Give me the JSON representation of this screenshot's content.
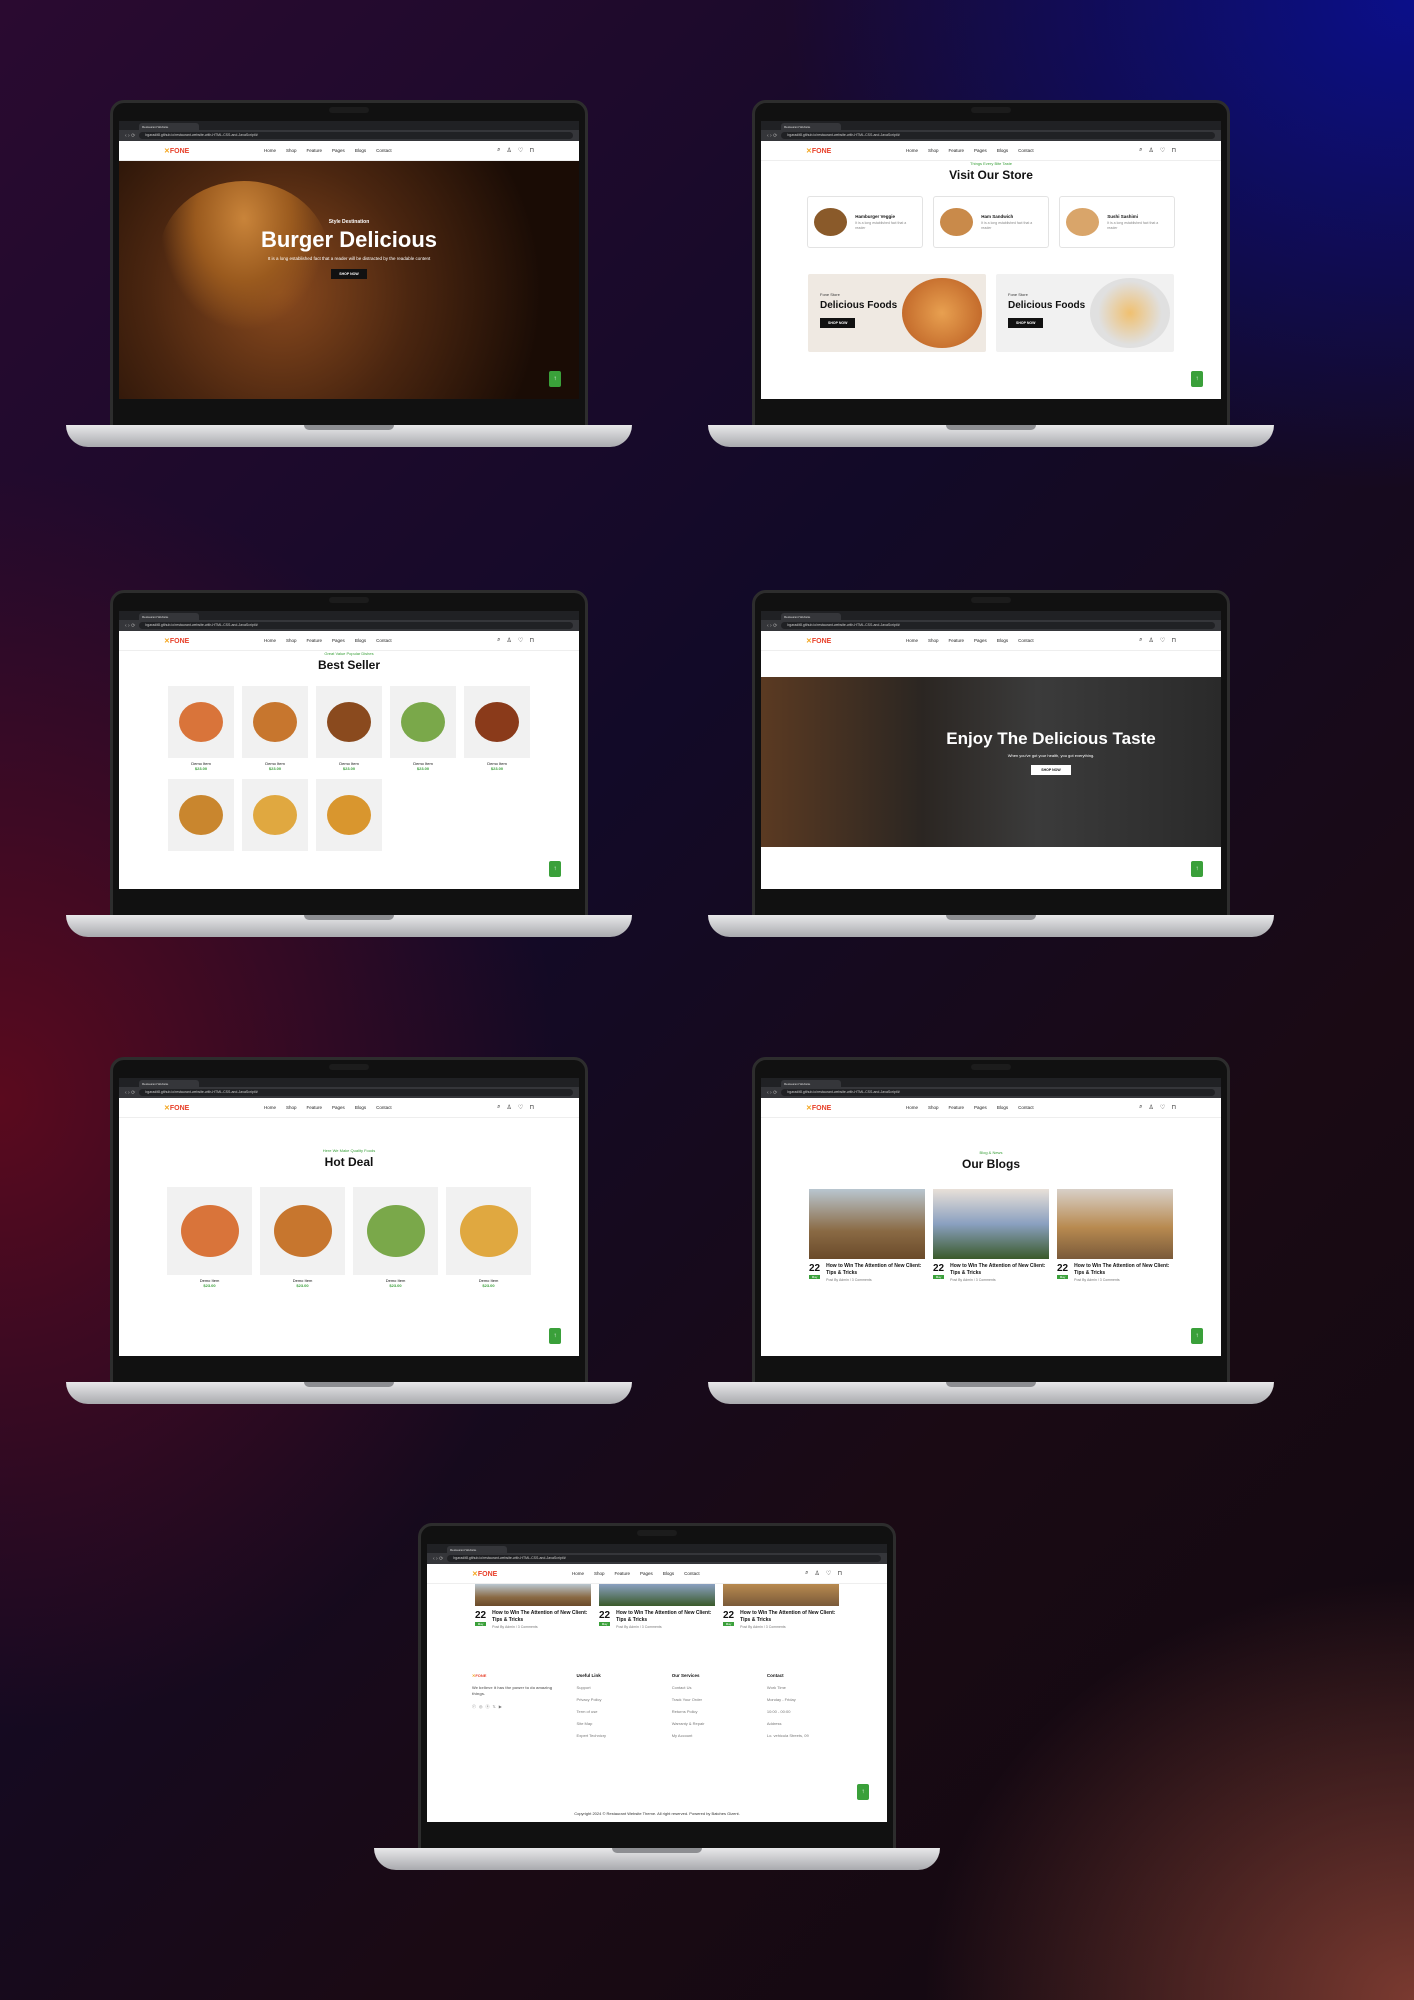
{
  "browser": {
    "tab_title": "Restaurant Website",
    "url": "bgaradit8.github.io/restaurant-website-with-HTML-CSS-and-JavaScript/#"
  },
  "site": {
    "logo_main": "FONE",
    "logo_mark": "✕",
    "nav": [
      "Home",
      "Shop",
      "Feature",
      "Pages",
      "Blogs",
      "Contact"
    ]
  },
  "hero": {
    "kicker": "Style Destination",
    "title": "Burger Delicious",
    "text": "It is a long established fact that a reader will be distracted by the readable content",
    "button": "SHOP NOW"
  },
  "store": {
    "subtitle": "Things Every Bite Taste",
    "title": "Visit Our Store",
    "categories": [
      {
        "name": "Hamburger Veggie",
        "desc": "It is a long established fact that a reader",
        "color": "#8a5a2a"
      },
      {
        "name": "Ham Sandwich",
        "desc": "It is a long established fact that a reader",
        "color": "#c98a4a"
      },
      {
        "name": "Sushi Sashimi",
        "desc": "It is a long established fact that a reader",
        "color": "#d9a56a"
      }
    ],
    "promos": [
      {
        "small": "Fone Store",
        "title": "Delicious Foods",
        "button": "SHOP NOW",
        "bg": "#efe9e2",
        "img": "#d98a2a"
      },
      {
        "small": "Fone Store",
        "title": "Delicious Foods",
        "button": "SHOP NOW",
        "bg": "#f1f1f1",
        "img": "#e0a050"
      }
    ]
  },
  "best_seller": {
    "subtitle": "Great Value Popular Dishes",
    "title": "Best Seller",
    "items": [
      {
        "name": "Demo Item",
        "price": "$23.00",
        "color": "#d9743a"
      },
      {
        "name": "Demo Item",
        "price": "$23.00",
        "color": "#c7762e"
      },
      {
        "name": "Demo Item",
        "price": "$23.00",
        "color": "#8a4a1e"
      },
      {
        "name": "Demo Item",
        "price": "$23.00",
        "color": "#7aa84a"
      },
      {
        "name": "Demo Item",
        "price": "$23.00",
        "color": "#8a3a1a"
      },
      {
        "name": "",
        "price": "",
        "color": "#c9862e"
      },
      {
        "name": "",
        "price": "",
        "color": "#e0a840"
      },
      {
        "name": "",
        "price": "",
        "color": "#d9962e"
      }
    ]
  },
  "enjoy": {
    "title": "Enjoy The Delicious Taste",
    "text": "When you've got your health, you got everything.",
    "button": "SHOP NOW"
  },
  "hot_deal": {
    "subtitle": "Here We Make Quality Foods",
    "title": "Hot Deal",
    "items": [
      {
        "name": "Demo Item",
        "price": "$23.00",
        "color": "#d9743a"
      },
      {
        "name": "Demo Item",
        "price": "$23.00",
        "color": "#c7762e"
      },
      {
        "name": "Demo Item",
        "price": "$23.00",
        "color": "#7aa84a"
      },
      {
        "name": "Demo Item",
        "price": "$23.00",
        "color": "#e0a840"
      }
    ]
  },
  "blogs": {
    "subtitle": "Blog & News",
    "title": "Our Blogs",
    "posts": [
      {
        "day": "22",
        "month": "May",
        "title": "How to Win The Attention of New Client: Tips & Tricks",
        "by": "Post By Admin / 3 Comments"
      },
      {
        "day": "22",
        "month": "May",
        "title": "How to Win The Attention of New Client: Tips & Tricks",
        "by": "Post By Admin / 3 Comments"
      },
      {
        "day": "22",
        "month": "May",
        "title": "How to Win The Attention of New Client: Tips & Tricks",
        "by": "Post By Admin / 3 Comments"
      }
    ]
  },
  "footer": {
    "tagline": "We believe it has the power to do amazing things.",
    "columns": [
      {
        "title": "Useful Link",
        "links": [
          "Support",
          "Privacy Policy",
          "Term of use",
          "Site Map",
          "Expert Technicry"
        ]
      },
      {
        "title": "Our Services",
        "links": [
          "Contact Us",
          "Track Your Order",
          "Returns Policy",
          "Warranty & Repair",
          "My Account"
        ]
      },
      {
        "title": "Contact",
        "links": [
          "Work Time",
          "Monday - Friday",
          "10:00 - 00:00",
          "Address",
          "Lo. vehicula Streets, 09"
        ]
      }
    ],
    "copyright": "Copyright 2024 © Restaurant Website Theme. All right reserved. Powered by Batches Gizent."
  },
  "colors": {
    "accent": "#3aa03a",
    "brand": "#e8402a"
  }
}
